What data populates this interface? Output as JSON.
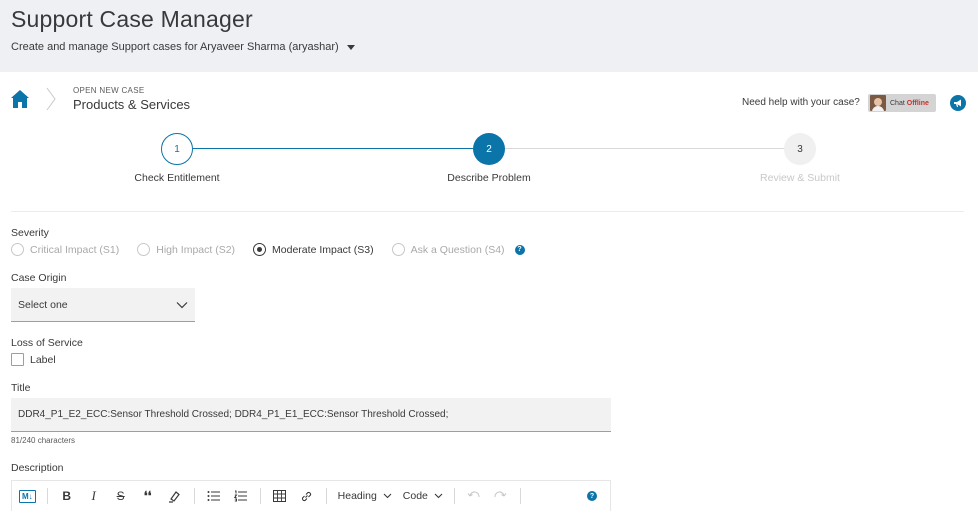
{
  "header": {
    "title": "Support Case Manager",
    "subtitle": "Create and manage Support cases for Aryaveer Sharma (aryashar)"
  },
  "breadcrumb": {
    "kicker": "OPEN NEW CASE",
    "title": "Products & Services"
  },
  "help": {
    "text": "Need help with your case?",
    "chat_prefix": "Chat",
    "chat_status": "Offline"
  },
  "stepper": {
    "steps": [
      {
        "number": "1",
        "label": "Check Entitlement",
        "state": "completed"
      },
      {
        "number": "2",
        "label": "Describe Problem",
        "state": "active"
      },
      {
        "number": "3",
        "label": "Review & Submit",
        "state": "pending"
      }
    ]
  },
  "severity": {
    "label": "Severity",
    "options": [
      {
        "label": "Critical Impact (S1)",
        "checked": false
      },
      {
        "label": "High Impact (S2)",
        "checked": false
      },
      {
        "label": "Moderate Impact (S3)",
        "checked": true
      },
      {
        "label": "Ask a Question (S4)",
        "checked": false
      }
    ]
  },
  "case_origin": {
    "label": "Case Origin",
    "value": "Select one"
  },
  "loss_of_service": {
    "label": "Loss of Service",
    "checkbox_label": "Label",
    "checked": false
  },
  "title_field": {
    "label": "Title",
    "value": "DDR4_P1_E2_ECC:Sensor Threshold Crossed; DDR4_P1_E1_ECC:Sensor Threshold Crossed;",
    "char_count": "81/240 characters"
  },
  "description": {
    "label": "Description",
    "toolbar": {
      "markdown_badge": "M↓",
      "bold": "B",
      "italic": "I",
      "strike": "S",
      "quote": "❛❛",
      "heading": "Heading",
      "code": "Code"
    }
  },
  "colors": {
    "accent": "#0b74a9",
    "header_bg": "#eef0f3",
    "text": "#39393b",
    "offline": "#c3332b"
  }
}
